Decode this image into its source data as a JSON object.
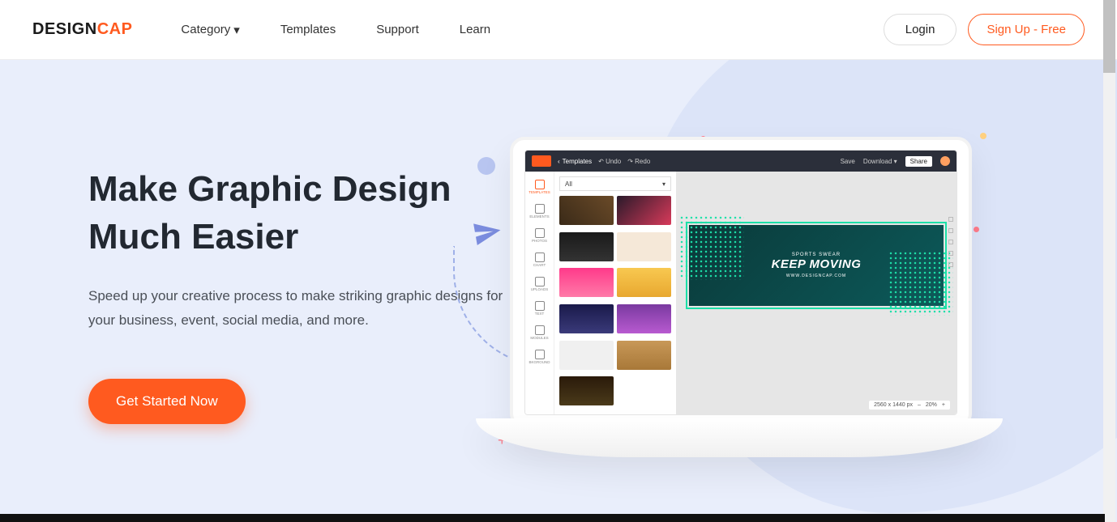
{
  "brand": {
    "prefix": "DESIGN",
    "suffix": "CAP"
  },
  "nav": {
    "category": "Category",
    "templates": "Templates",
    "support": "Support",
    "learn": "Learn"
  },
  "auth": {
    "login": "Login",
    "signup": "Sign Up - Free"
  },
  "hero": {
    "title_line1": "Make Graphic Design",
    "title_line2": "Much Easier",
    "subtitle": "Speed up your creative process to make striking graphic designs for your business, event, social media, and more.",
    "cta": "Get Started Now"
  },
  "editor": {
    "toolbar": {
      "templates": "Templates",
      "undo": "Undo",
      "redo": "Redo",
      "save": "Save",
      "download": "Download",
      "share": "Share"
    },
    "rail": {
      "templates": "TEMPLATES",
      "elements": "ELEMENTS",
      "photos": "PHOTOS",
      "chart": "CHART",
      "uploads": "UPLOADS",
      "text": "TEXT",
      "modules": "MODULES",
      "bkground": "BKGROUND"
    },
    "template_filter": "All",
    "canvas": {
      "tagline": "SPORTS SWEAR",
      "headline": "KEEP MOVING",
      "url": "WWW.DESIGNCAP.COM"
    },
    "zoom": {
      "dims": "2560 x 1440 px",
      "minus": "–",
      "pct": "20%",
      "plus": "+"
    }
  }
}
